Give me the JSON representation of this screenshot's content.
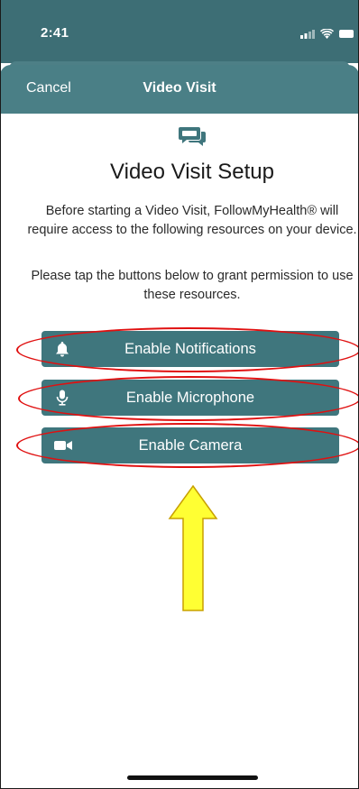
{
  "status_bar": {
    "time": "2:41",
    "icons": [
      "signal-icon",
      "wifi-icon",
      "battery-icon"
    ]
  },
  "nav": {
    "cancel_label": "Cancel",
    "title": "Video Visit"
  },
  "content": {
    "header_icon": "chat-bubbles-icon",
    "title": "Video Visit Setup",
    "description": "Before starting a Video Visit, FollowMyHealth® will require access to the following resources on your device.",
    "instruction": "Please tap the buttons below to grant permission to use these resources."
  },
  "buttons": {
    "notifications": {
      "label": "Enable Notifications",
      "icon": "bell-icon"
    },
    "microphone": {
      "label": "Enable Microphone",
      "icon": "microphone-icon"
    },
    "camera": {
      "label": "Enable Camera",
      "icon": "video-camera-icon"
    }
  },
  "annotations": {
    "ellipse_color": "#e01010",
    "arrow_fill": "#ffff33",
    "arrow_stroke": "#c8a000"
  },
  "colors": {
    "header_teal": "#4a7f86",
    "status_teal": "#3d6e75",
    "button_teal": "#3f767d",
    "icon_teal": "#3f767d"
  }
}
